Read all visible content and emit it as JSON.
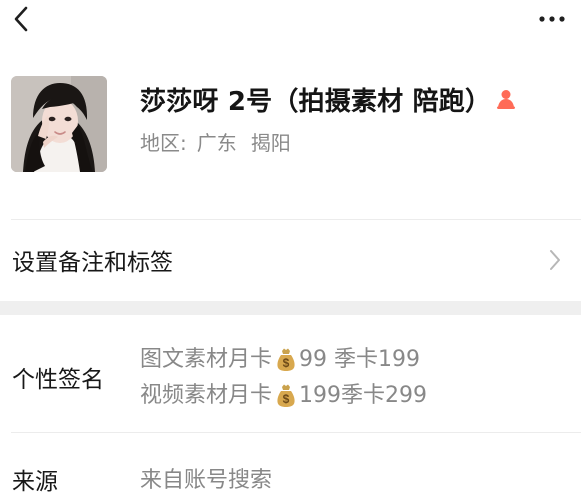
{
  "profile": {
    "nickname": "莎莎呀 2号（拍摄素材 陪跑）",
    "region_label": "地区:",
    "province": "广东",
    "city": "揭阳",
    "avatar_icon": "avatar-photo",
    "person_icon": "person-icon"
  },
  "settings": {
    "remark_tags_label": "设置备注和标签"
  },
  "signature": {
    "title": "个性签名",
    "line1_prefix": "图文素材月卡",
    "line1_suffix": "99 季卡199",
    "line2_prefix": "视频素材月卡",
    "line2_suffix": "199季卡299"
  },
  "source": {
    "title": "来源",
    "value": "来自账号搜索"
  },
  "icons": {
    "back": "chevron-left-icon",
    "more": "more-icon",
    "next": "chevron-right-icon",
    "money": "money-bag-icon"
  },
  "colors": {
    "primary_text": "#181818",
    "secondary_text": "#888888",
    "divider": "#ececec",
    "section_gap": "#efefef",
    "person_icon": "#ff6b57",
    "money_bag": "#d8a84e"
  }
}
